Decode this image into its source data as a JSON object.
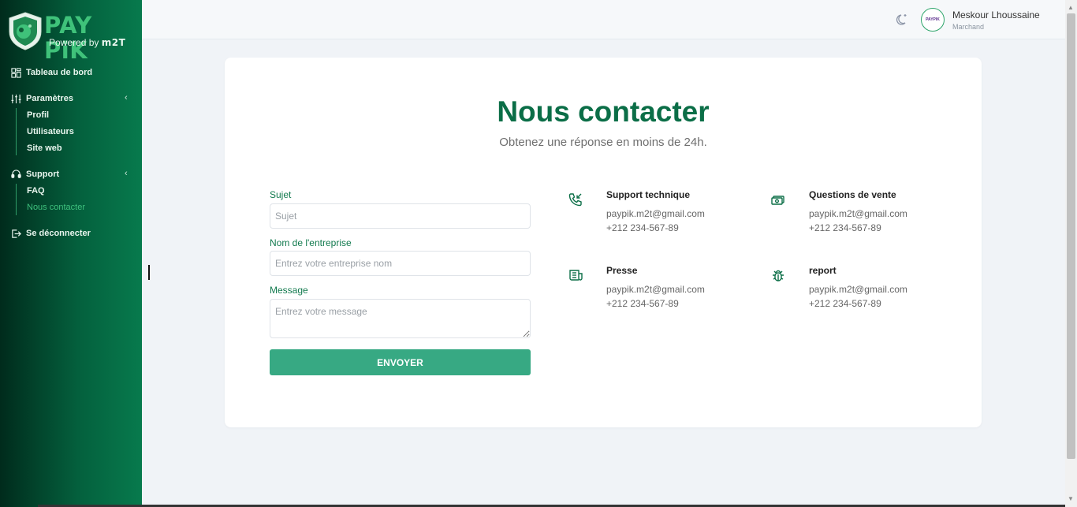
{
  "brand": {
    "name": "PAY PiK",
    "powered_by": "Powered by",
    "powered_brand": "m2T"
  },
  "sidebar": {
    "dashboard": "Tableau de bord",
    "settings": {
      "label": "Paramètres",
      "items": [
        "Profil",
        "Utilisateurs",
        "Site web"
      ]
    },
    "support": {
      "label": "Support",
      "items": [
        "FAQ",
        "Nous contacter"
      ]
    },
    "logout": "Se déconnecter"
  },
  "header": {
    "user_name": "Meskour Lhoussaine",
    "user_role": "Marchand",
    "avatar_text": "PAYPIK"
  },
  "page": {
    "title": "Nous contacter",
    "subtitle": "Obtenez une réponse en moins de 24h."
  },
  "form": {
    "subject_label": "Sujet",
    "subject_placeholder": "Sujet",
    "company_label": "Nom de l'entreprise",
    "company_placeholder": "Entrez votre entreprise nom",
    "message_label": "Message",
    "message_placeholder": "Entrez votre message",
    "submit": "ENVOYER"
  },
  "contacts": [
    {
      "title": "Support technique",
      "email": "paypik.m2t@gmail.com",
      "phone": "+212 234-567-89",
      "icon": "phone-incoming-icon"
    },
    {
      "title": "Questions de vente",
      "email": "paypik.m2t@gmail.com",
      "phone": "+212 234-567-89",
      "icon": "cash-icon"
    },
    {
      "title": "Presse",
      "email": "paypik.m2t@gmail.com",
      "phone": "+212 234-567-89",
      "icon": "news-icon"
    },
    {
      "title": "report",
      "email": "paypik.m2t@gmail.com",
      "phone": "+212 234-567-89",
      "icon": "bug-icon"
    }
  ],
  "colors": {
    "primary": "#0b6e47",
    "button": "#37a983",
    "accent": "#3ec07d"
  }
}
